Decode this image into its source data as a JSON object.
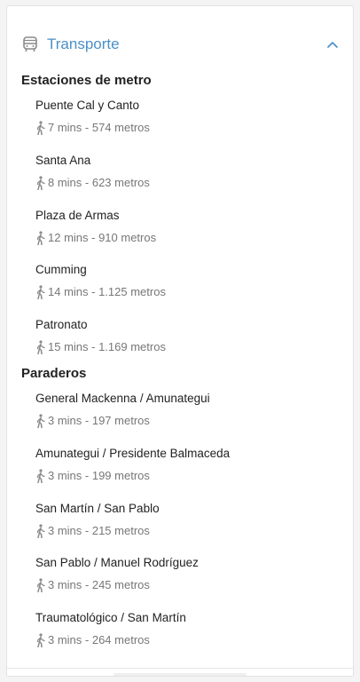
{
  "panel": {
    "title": "Transporte",
    "icon": "bus-icon",
    "collapse_icon": "chevron-up-icon",
    "accent_color": "#4a90c8"
  },
  "metro": {
    "title": "Estaciones de metro",
    "items": [
      {
        "name": "Puente Cal y Canto",
        "distance": "7 mins - 574 metros"
      },
      {
        "name": "Santa Ana",
        "distance": "8 mins - 623 metros"
      },
      {
        "name": "Plaza de Armas",
        "distance": "12 mins - 910 metros"
      },
      {
        "name": "Cumming",
        "distance": "14 mins - 1.125 metros"
      },
      {
        "name": "Patronato",
        "distance": "15 mins - 1.169 metros"
      }
    ]
  },
  "stops": {
    "title": "Paraderos",
    "items": [
      {
        "name": "General Mackenna / Amunategui",
        "distance": "3 mins - 197 metros"
      },
      {
        "name": "Amunategui / Presidente Balmaceda",
        "distance": "3 mins - 199 metros"
      },
      {
        "name": "San Martín / San Pablo",
        "distance": "3 mins - 215 metros"
      },
      {
        "name": "San Pablo / Manuel Rodríguez",
        "distance": "3 mins - 245 metros"
      },
      {
        "name": "Traumatológico / San Martín",
        "distance": "3 mins - 264 metros"
      }
    ]
  }
}
